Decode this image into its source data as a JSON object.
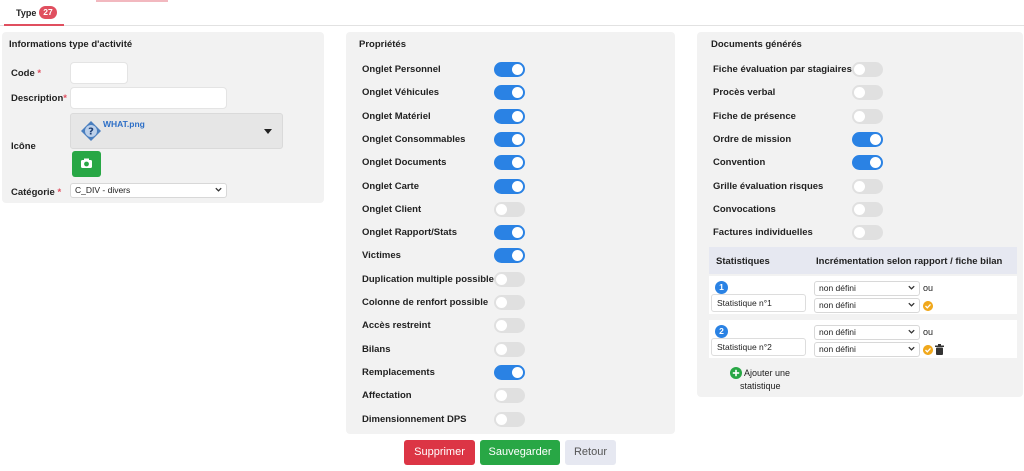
{
  "tabs": [
    {
      "label": "Type",
      "badge": "27"
    }
  ],
  "left_panel": {
    "title": "Informations type d'activité",
    "code_label": "Code",
    "description_label": "Description",
    "required_mark": "*",
    "icon_label": "Icône",
    "icon_file": "WHAT.png",
    "category_label": "Catégorie",
    "category_value": "C_DIV - divers"
  },
  "properties": {
    "title": "Propriétés",
    "items": [
      {
        "label": "Onglet Personnel",
        "on": true
      },
      {
        "label": "Onglet Véhicules",
        "on": true
      },
      {
        "label": "Onglet Matériel",
        "on": true
      },
      {
        "label": "Onglet Consommables",
        "on": true
      },
      {
        "label": "Onglet Documents",
        "on": true
      },
      {
        "label": "Onglet Carte",
        "on": true
      },
      {
        "label": "Onglet Client",
        "on": false
      },
      {
        "label": "Onglet Rapport/Stats",
        "on": true
      },
      {
        "label": "Victimes",
        "on": true
      },
      {
        "label": "Duplication multiple possible",
        "on": false
      },
      {
        "label": "Colonne de renfort possible",
        "on": false
      },
      {
        "label": "Accès restreint",
        "on": false
      },
      {
        "label": "Bilans",
        "on": false
      },
      {
        "label": "Remplacements",
        "on": true
      },
      {
        "label": "Affectation",
        "on": false
      },
      {
        "label": "Dimensionnement DPS",
        "on": false
      }
    ]
  },
  "documents": {
    "title": "Documents générés",
    "items": [
      {
        "label": "Fiche évaluation par stagiaires",
        "on": false
      },
      {
        "label": "Procès verbal",
        "on": false
      },
      {
        "label": "Fiche de présence",
        "on": false
      },
      {
        "label": "Ordre de mission",
        "on": true
      },
      {
        "label": "Convention",
        "on": true
      },
      {
        "label": "Grille évaluation risques",
        "on": false
      },
      {
        "label": "Convocations",
        "on": false
      },
      {
        "label": "Factures individuelles",
        "on": false
      }
    ]
  },
  "statistics": {
    "col1": "Statistiques",
    "col2": "Incrémentation selon rapport / fiche bilan",
    "rows": [
      {
        "number": "1",
        "name": "Statistique n°1",
        "select1": "non défini",
        "select2": "non défini",
        "ou": "ou"
      },
      {
        "number": "2",
        "name": "Statistique n°2",
        "select1": "non défini",
        "select2": "non défini",
        "ou": "ou"
      }
    ],
    "add_line1": "Ajouter une",
    "add_line2": "statistique"
  },
  "actions": {
    "delete": "Supprimer",
    "save": "Sauvegarder",
    "back": "Retour"
  },
  "colors": {
    "accent": "#2a82e4",
    "danger": "#dc3545",
    "success": "#28a745",
    "badge": "#e04f5f"
  }
}
